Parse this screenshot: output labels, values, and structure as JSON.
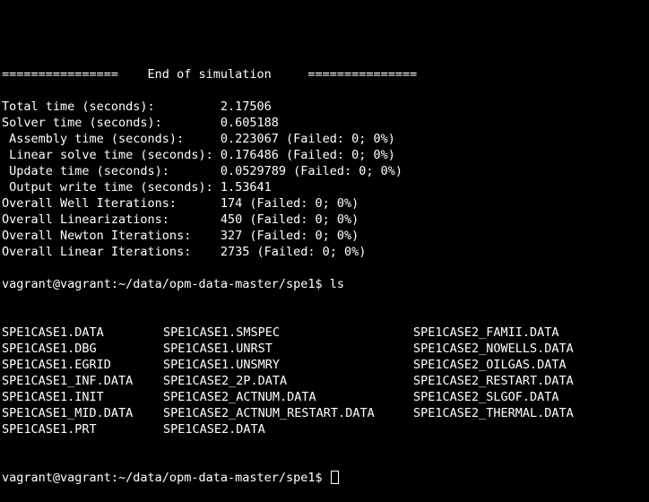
{
  "terminal": {
    "lines": [
      "================    End of simulation     ===============",
      "",
      "Total time (seconds):         2.17506",
      "Solver time (seconds):        0.605188",
      " Assembly time (seconds):     0.223067 (Failed: 0; 0%)",
      " Linear solve time (seconds): 0.176486 (Failed: 0; 0%)",
      " Update time (seconds):       0.0529789 (Failed: 0; 0%)",
      " Output write time (seconds): 1.53641",
      "Overall Well Iterations:      174 (Failed: 0; 0%)",
      "Overall Linearizations:       450 (Failed: 0; 0%)",
      "Overall Newton Iterations:    327 (Failed: 0; 0%)",
      "Overall Linear Iterations:    2735 (Failed: 0; 0%)",
      "",
      "vagrant@vagrant:~/data/opm-data-master/spe1$ ls"
    ],
    "ls_files": [
      [
        "SPE1CASE1.DATA",
        "SPE1CASE1.SMSPEC",
        "SPE1CASE2_FAMII.DATA"
      ],
      [
        "SPE1CASE1.DBG",
        "SPE1CASE1.UNRST",
        "SPE1CASE2_NOWELLS.DATA"
      ],
      [
        "SPE1CASE1.EGRID",
        "SPE1CASE1.UNSMRY",
        "SPE1CASE2_OILGAS.DATA"
      ],
      [
        "SPE1CASE1_INF.DATA",
        "SPE1CASE2_2P.DATA",
        "SPE1CASE2_RESTART.DATA"
      ],
      [
        "SPE1CASE1.INIT",
        "SPE1CASE2_ACTNUM.DATA",
        "SPE1CASE2_SLGOF.DATA"
      ],
      [
        "SPE1CASE1_MID.DATA",
        "SPE1CASE2_ACTNUM_RESTART.DATA",
        "SPE1CASE2_THERMAL.DATA"
      ],
      [
        "SPE1CASE1.PRT",
        "SPE1CASE2.DATA",
        ""
      ]
    ],
    "prompt": "vagrant@vagrant:~/data/opm-data-master/spe1$ ",
    "colors": {
      "background": "#000000",
      "foreground": "#ffffff"
    }
  }
}
